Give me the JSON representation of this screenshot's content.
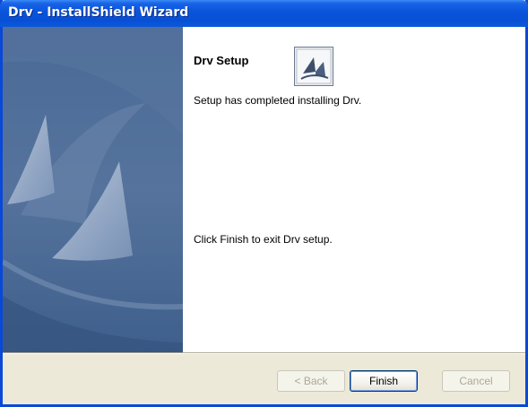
{
  "window": {
    "title": "Drv - InstallShield Wizard"
  },
  "content": {
    "heading": "Drv Setup",
    "message_completed": "Setup has completed installing Drv.",
    "message_exit": "Click Finish to exit Drv setup."
  },
  "buttons": {
    "back_label": "< Back",
    "finish_label": "Finish",
    "cancel_label": "Cancel"
  },
  "icons": {
    "logo": "installshield-logo-icon",
    "banner": "sails-banner-graphic"
  },
  "colors": {
    "titlebar": "#0a55dc",
    "panel_blue": "#4f6b93",
    "dialog_bg": "#ece9d8"
  }
}
